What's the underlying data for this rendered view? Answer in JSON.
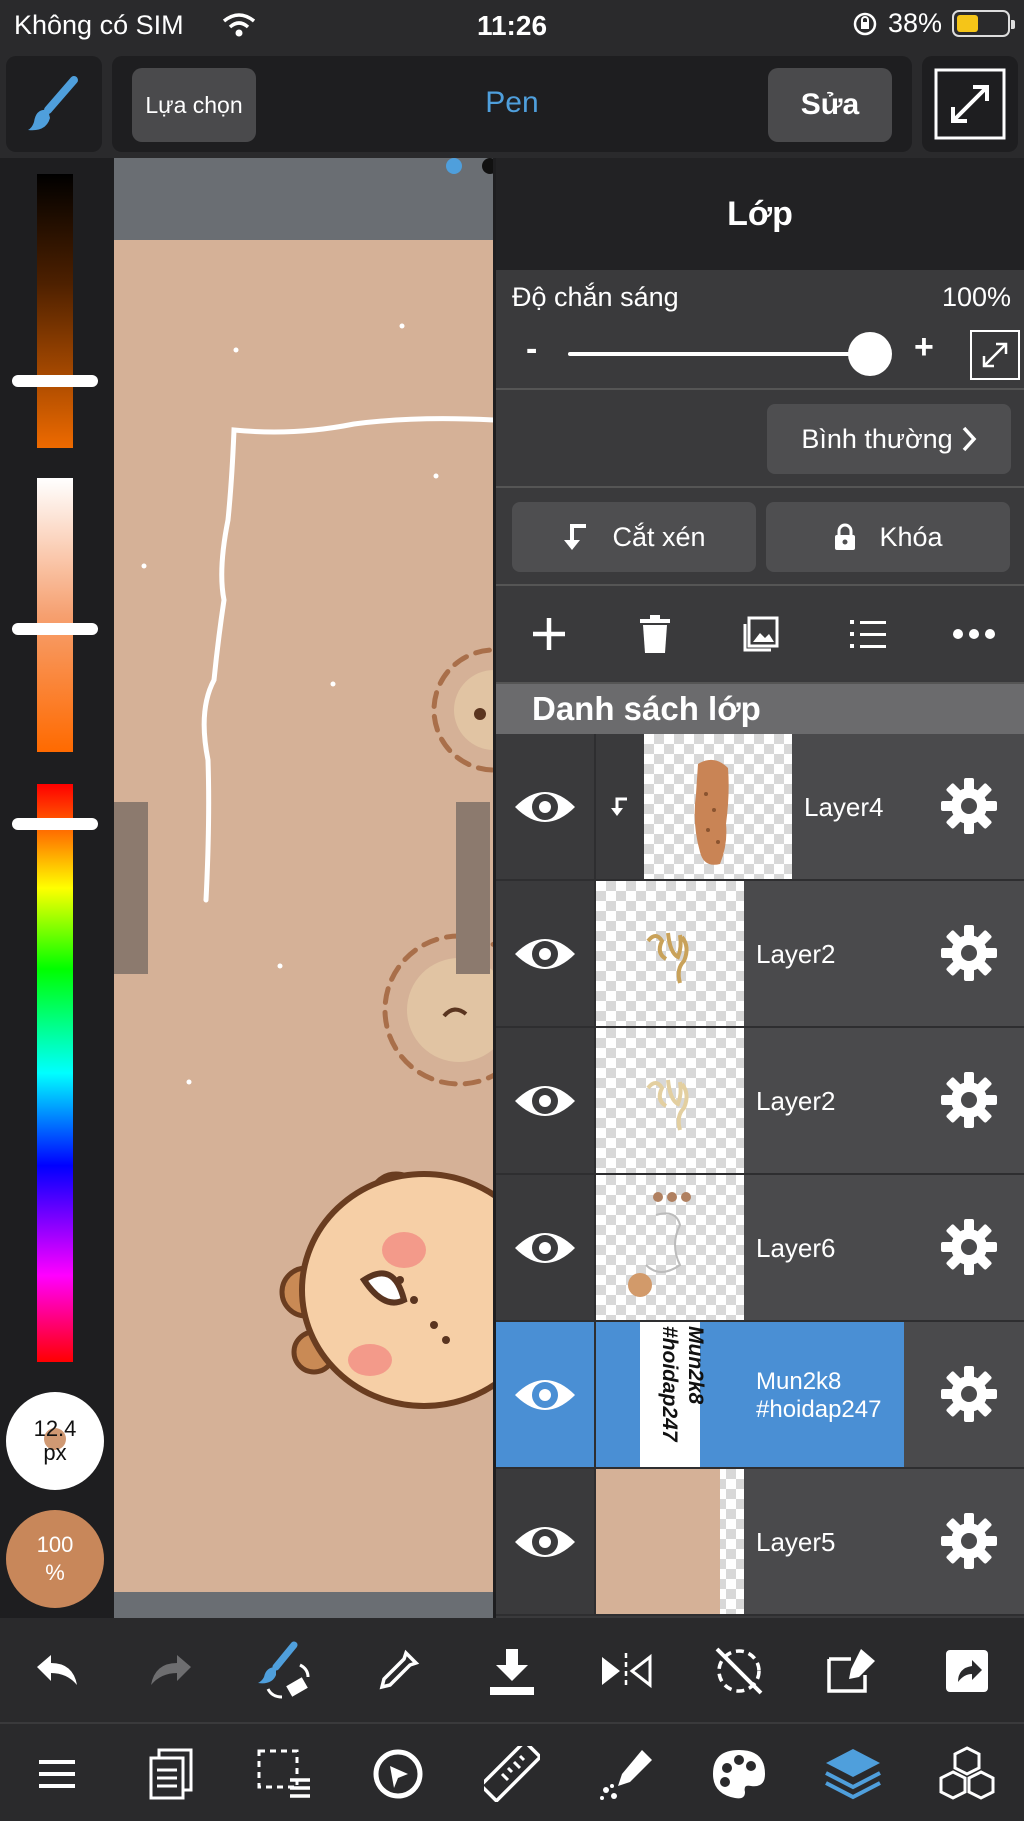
{
  "status_bar": {
    "carrier": "Không có SIM",
    "time": "11:26",
    "battery": "38%"
  },
  "toolbar": {
    "select_label": "Lựa chọn",
    "tool_name": "Pen",
    "edit_label": "Sửa"
  },
  "brush": {
    "size_value": "12.4",
    "size_unit": "px",
    "opacity_value": "100",
    "opacity_unit": "%"
  },
  "layers_panel": {
    "title": "Lớp",
    "opacity_label": "Độ chắn sáng",
    "opacity_value": "100%",
    "opacity_minus": "-",
    "opacity_plus": "+",
    "blend_mode": "Bình thường",
    "clipping_label": "Cắt xén",
    "lock_label": "Khóa",
    "list_title": "Danh sách lớp",
    "layers": [
      {
        "name": "Layer4"
      },
      {
        "name": "Layer2"
      },
      {
        "name": "Layer2"
      },
      {
        "name": "Layer6"
      },
      {
        "name_line1": "Mun2k8",
        "name_line2": "#hoidap247",
        "thumb_line1": "Mun2k8",
        "thumb_line2": "#hoidap247"
      },
      {
        "name": "Layer5"
      }
    ]
  },
  "colors": {
    "accent": "#4a8fd4",
    "tool_blue": "#4f9fdc",
    "paper": "#d5b197",
    "brush_color": "#c8875a"
  }
}
